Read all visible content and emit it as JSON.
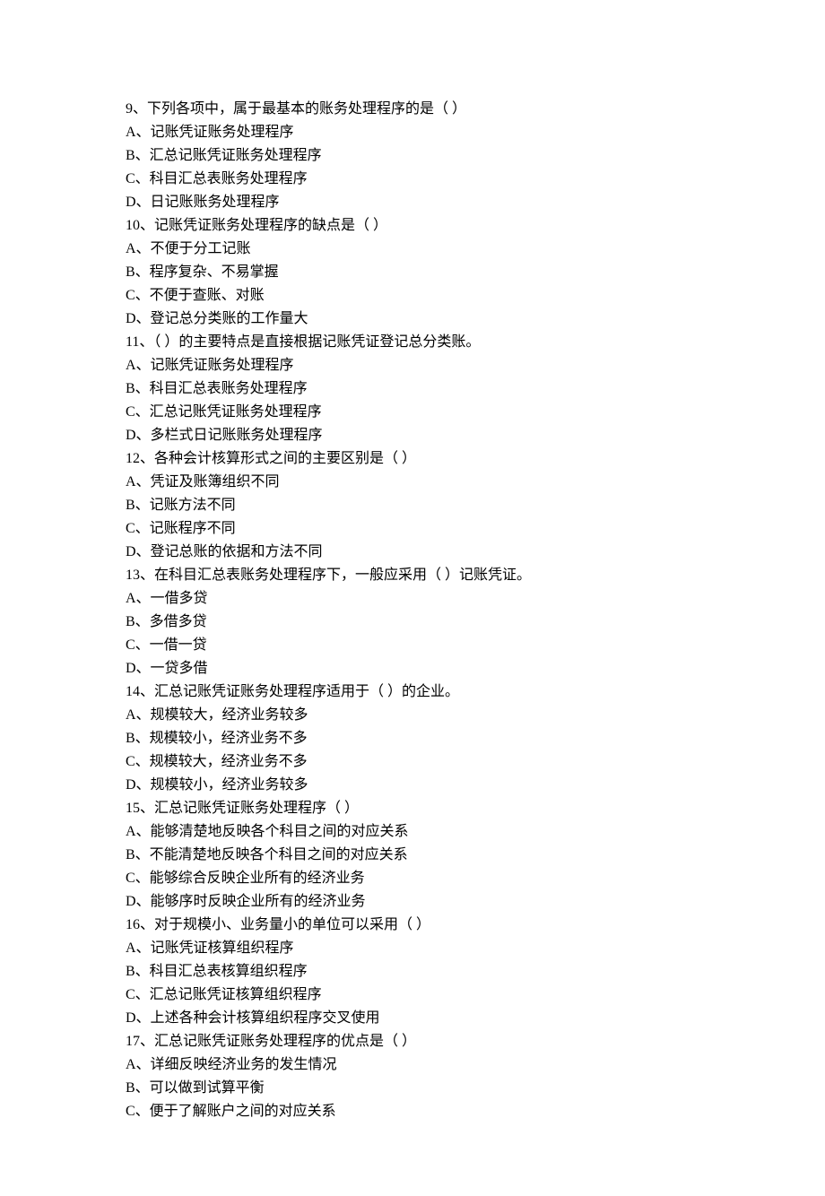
{
  "questions": [
    {
      "stem": "9、下列各项中，属于最基本的账务处理程序的是（  ）",
      "options": [
        "A、记账凭证账务处理程序",
        "B、汇总记账凭证账务处理程序",
        "C、科目汇总表账务处理程序",
        "D、日记账账务处理程序"
      ]
    },
    {
      "stem": "10、记账凭证账务处理程序的缺点是（  ）",
      "options": [
        "A、不便于分工记账",
        "B、程序复杂、不易掌握",
        "C、不便于查账、对账",
        "D、登记总分类账的工作量大"
      ]
    },
    {
      "stem": "11、（  ）的主要特点是直接根据记账凭证登记总分类账。",
      "options": [
        "A、记账凭证账务处理程序",
        "B、科目汇总表账务处理程序",
        "C、汇总记账凭证账务处理程序",
        "D、多栏式日记账账务处理程序"
      ]
    },
    {
      "stem": "12、各种会计核算形式之间的主要区别是（  ）",
      "options": [
        "A、凭证及账簿组织不同",
        "B、记账方法不同",
        "C、记账程序不同",
        "D、登记总账的依据和方法不同"
      ]
    },
    {
      "stem": "13、在科目汇总表账务处理程序下，一般应采用（  ）记账凭证。",
      "options": [
        "A、一借多贷",
        "B、多借多贷",
        "C、一借一贷",
        "D、一贷多借"
      ]
    },
    {
      "stem": "14、汇总记账凭证账务处理程序适用于（  ）的企业。",
      "options": [
        "A、规模较大，经济业务较多",
        "B、规模较小，经济业务不多",
        "C、规模较大，经济业务不多",
        "D、规模较小，经济业务较多"
      ]
    },
    {
      "stem": "15、汇总记账凭证账务处理程序（  ）",
      "options": [
        "A、能够清楚地反映各个科目之间的对应关系",
        "B、不能清楚地反映各个科目之间的对应关系",
        "C、能够综合反映企业所有的经济业务",
        "D、能够序时反映企业所有的经济业务"
      ]
    },
    {
      "stem": "16、对于规模小、业务量小的单位可以采用（  ）",
      "options": [
        "A、记账凭证核算组织程序",
        "B、科目汇总表核算组织程序",
        "C、汇总记账凭证核算组织程序",
        "D、上述各种会计核算组织程序交叉使用"
      ]
    },
    {
      "stem": "17、汇总记账凭证账务处理程序的优点是（  ）",
      "options": [
        "A、详细反映经济业务的发生情况",
        "B、可以做到试算平衡",
        "C、便于了解账户之间的对应关系"
      ]
    }
  ]
}
